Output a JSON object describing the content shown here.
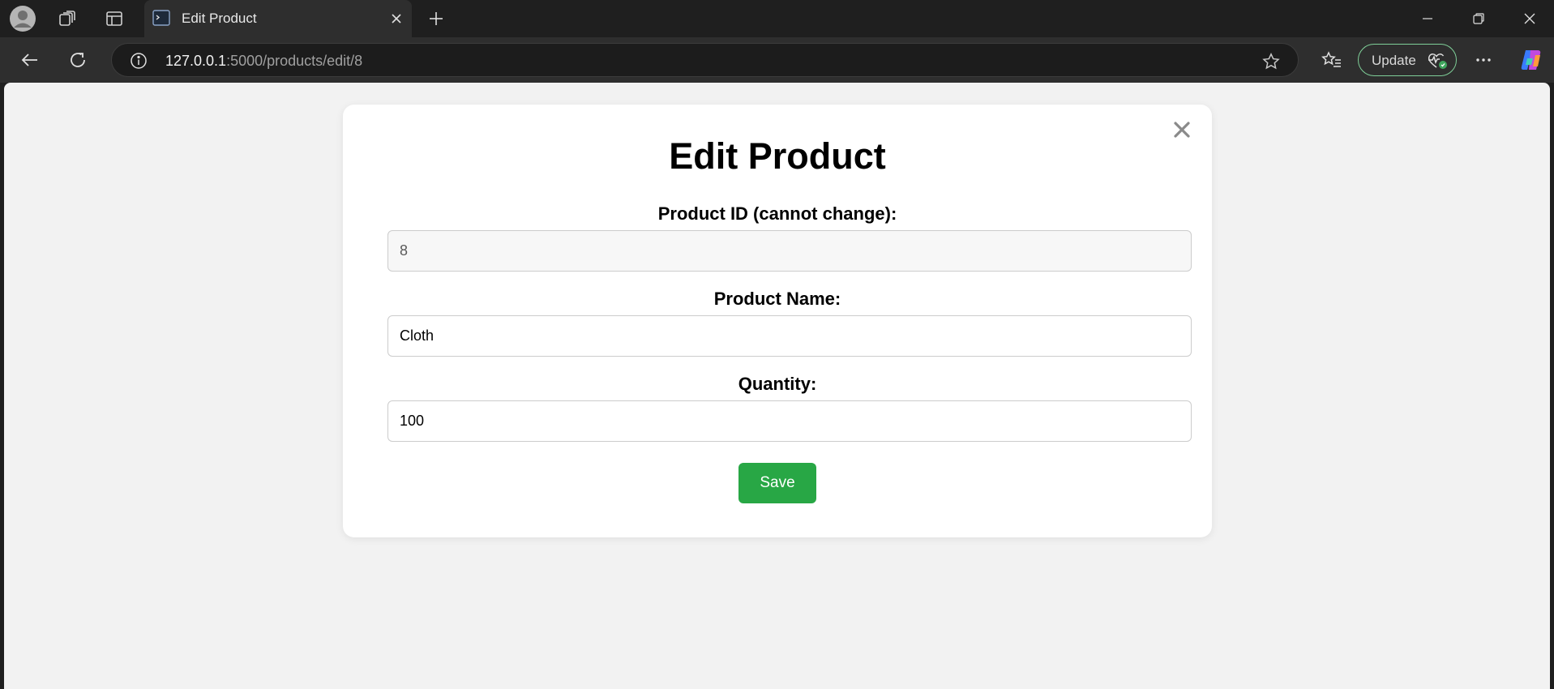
{
  "browser": {
    "tab": {
      "title": "Edit Product"
    },
    "address": {
      "host": "127.0.0.1",
      "path": ":5000/products/edit/8"
    },
    "update_label": "Update",
    "icons": {
      "profile": "profile-icon",
      "workspaces": "workspaces-icon",
      "tab_actions": "tab-actions-icon",
      "new_tab": "plus-icon",
      "back": "back-arrow-icon",
      "refresh": "refresh-icon",
      "site_info": "info-icon",
      "favorite": "star-icon",
      "favorites": "favorites-icon",
      "more": "more-icon",
      "copilot": "copilot-icon"
    }
  },
  "form": {
    "title": "Edit Product",
    "product_id_label": "Product ID (cannot change):",
    "product_id_value": "8",
    "product_name_label": "Product Name:",
    "product_name_value": "Cloth",
    "quantity_label": "Quantity:",
    "quantity_value": "100",
    "save_label": "Save"
  },
  "colors": {
    "save_button": "#28a745",
    "page_background": "#f2f2f2",
    "browser_chrome": "#1f1f1f"
  }
}
